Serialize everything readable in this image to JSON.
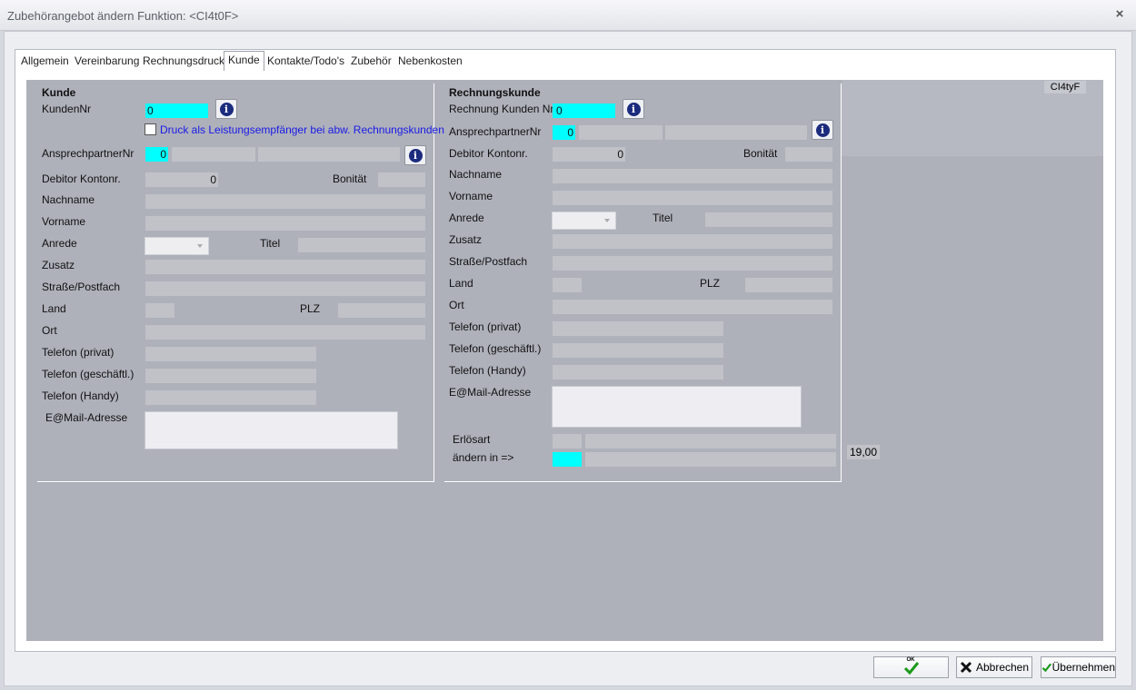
{
  "window": {
    "title": "Zubehörangebot ändern Funktion: <CI4t0F>",
    "close_glyph": "×"
  },
  "tabs": [
    "Allgemein",
    "Vereinbarung",
    "Rechnungsdruck",
    "Kunde",
    "Kontakte/Todo's",
    "Zubehör",
    "Nebenkosten"
  ],
  "active_tab": "Kunde",
  "code_label": "CI4tyF",
  "kunde": {
    "heading": "Kunde",
    "kundennr_label": "KundenNr",
    "kundennr_value": "0",
    "checkbox_label": "Druck als Leistungsempfänger bei abw. Rechnungskunden",
    "checkbox_checked": false,
    "ansprechpartner_label": "AnsprechpartnerNr",
    "ansprechpartner_value": "0",
    "debitor_label": "Debitor Kontonr.",
    "debitor_value": "0",
    "bonitaet_label": "Bonität",
    "nachname_label": "Nachname",
    "vorname_label": "Vorname",
    "anrede_label": "Anrede",
    "titel_label": "Titel",
    "zusatz_label": "Zusatz",
    "strasse_label": "Straße/Postfach",
    "land_label": "Land",
    "plz_label": "PLZ",
    "ort_label": "Ort",
    "tel_privat_label": "Telefon (privat)",
    "tel_geschaeft_label": "Telefon (geschäftl.)",
    "tel_handy_label": "Telefon (Handy)",
    "email_label": "E@Mail-Adresse"
  },
  "rechnungskunde": {
    "heading": "Rechnungskunde",
    "rechnung_kundennr_label": "Rechnung Kunden Nr",
    "rechnung_kundennr_value": "0",
    "ansprechpartner_label": "AnsprechpartnerNr",
    "ansprechpartner_value": "0",
    "debitor_label": "Debitor Kontonr.",
    "debitor_value": "0",
    "bonitaet_label": "Bonität",
    "nachname_label": "Nachname",
    "vorname_label": "Vorname",
    "anrede_label": "Anrede",
    "titel_label": "Titel",
    "zusatz_label": "Zusatz",
    "strasse_label": "Straße/Postfach",
    "land_label": "Land",
    "plz_label": "PLZ",
    "ort_label": "Ort",
    "tel_privat_label": "Telefon (privat)",
    "tel_geschaeft_label": "Telefon (geschäftl.)",
    "tel_handy_label": "Telefon (Handy)",
    "email_label": "E@Mail-Adresse",
    "erloesart_label": "Erlösart",
    "aendern_label": "ändern in =>",
    "rate_value": "19,00"
  },
  "buttons": {
    "ok": "OK",
    "abbrechen": "Abbrechen",
    "uebernehmen": "Übernehmen"
  },
  "colors": {
    "highlight_field": "#00ffff",
    "panel_bg": "#aeb1ba",
    "info_icon": "#1b2b7d",
    "link_text": "#1a1ae6"
  }
}
